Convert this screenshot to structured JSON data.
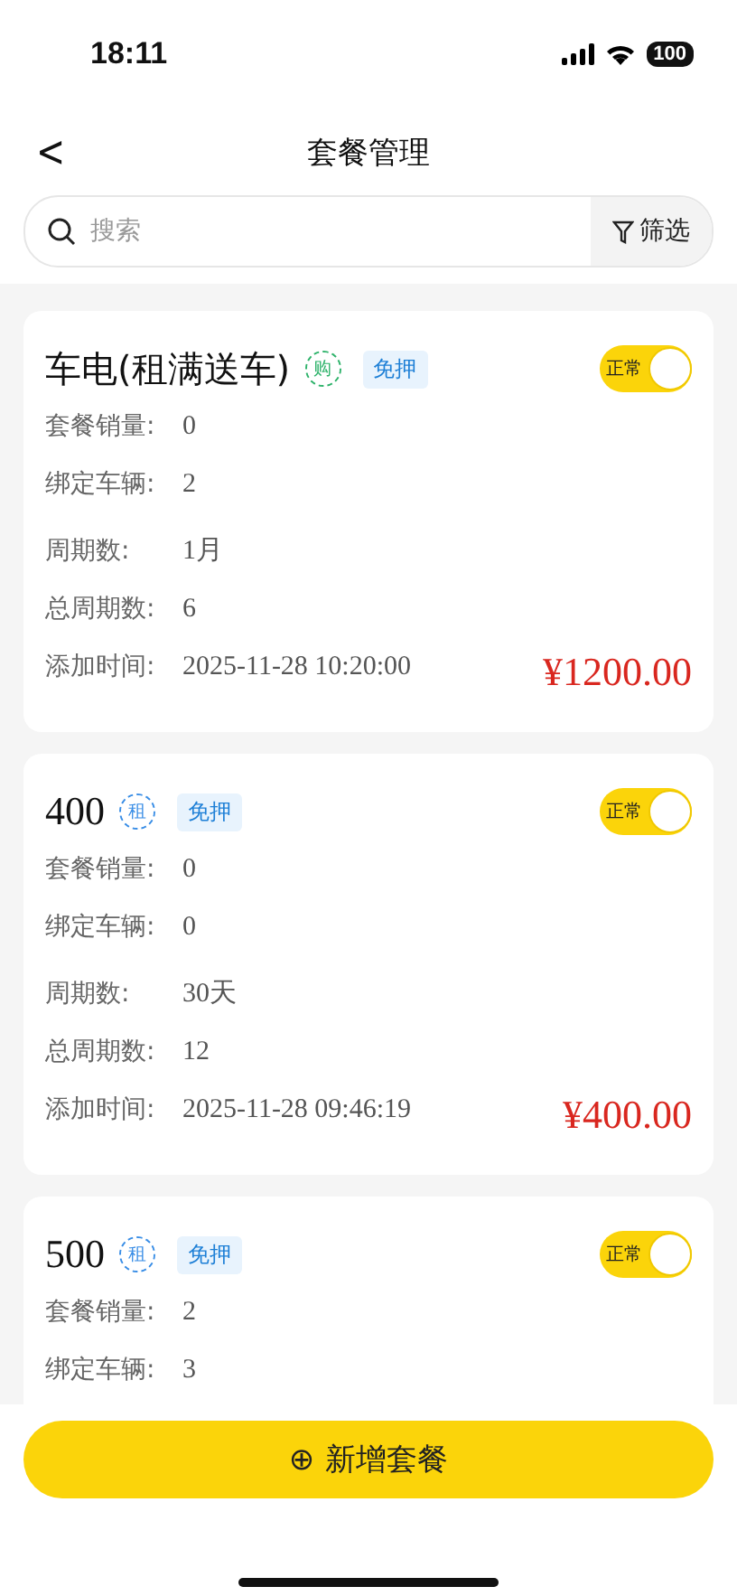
{
  "status_bar": {
    "time": "18:11",
    "battery": "100"
  },
  "nav": {
    "back": "<",
    "title": "套餐管理"
  },
  "search": {
    "placeholder": "搜索",
    "filter": "筛选"
  },
  "cards": [
    {
      "name": "车电(租满送车)",
      "badge": {
        "text": "购",
        "color": "#2fb36b"
      },
      "tag": "免押",
      "switch": {
        "label": "正常",
        "on": true
      },
      "rows": [
        {
          "label": "套餐销量:",
          "value": "0"
        },
        {
          "label": "绑定车辆:",
          "value": "2"
        },
        {
          "label": "周期数:",
          "value": "1月"
        },
        {
          "label": "总周期数:",
          "value": "6"
        },
        {
          "label": "添加时间:",
          "value": "2025-11-28 10:20:00"
        }
      ],
      "price": "¥1200.00"
    },
    {
      "name": "400",
      "badge": {
        "text": "租",
        "color": "#3a8ee6"
      },
      "tag": "免押",
      "switch": {
        "label": "正常",
        "on": true
      },
      "rows": [
        {
          "label": "套餐销量:",
          "value": "0"
        },
        {
          "label": "绑定车辆:",
          "value": "0"
        },
        {
          "label": "周期数:",
          "value": "30天"
        },
        {
          "label": "总周期数:",
          "value": "12"
        },
        {
          "label": "添加时间:",
          "value": "2025-11-28 09:46:19"
        }
      ],
      "price": "¥400.00"
    },
    {
      "name": "500",
      "badge": {
        "text": "租",
        "color": "#3a8ee6"
      },
      "tag": "免押",
      "switch": {
        "label": "正常",
        "on": true
      },
      "rows": [
        {
          "label": "套餐销量:",
          "value": "2"
        },
        {
          "label": "绑定车辆:",
          "value": "3"
        }
      ]
    }
  ],
  "add_button": {
    "icon": "⊕",
    "label": "新增套餐"
  }
}
